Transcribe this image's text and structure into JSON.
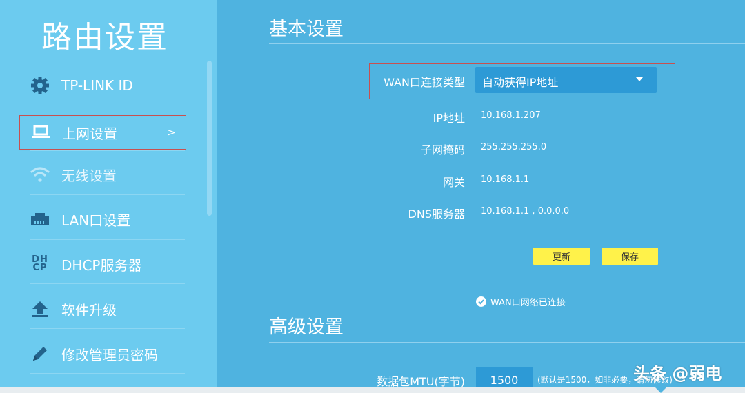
{
  "sidebar": {
    "title": "路由设置",
    "items": [
      {
        "label": "TP-LINK ID",
        "icon": "gear-icon"
      },
      {
        "label": "上网设置",
        "icon": "laptop-icon",
        "chevron": ">"
      },
      {
        "label": "无线设置",
        "icon": "wifi-icon"
      },
      {
        "label": "LAN口设置",
        "icon": "lan-port-icon"
      },
      {
        "label": "DHCP服务器",
        "icon": "dhcp-icon",
        "icon_text": "DH CP"
      },
      {
        "label": "软件升级",
        "icon": "upload-icon"
      },
      {
        "label": "修改管理员密码",
        "icon": "pencil-icon"
      }
    ]
  },
  "basic": {
    "title": "基本设置",
    "wan_type_label": "WAN口连接类型",
    "wan_type_value": "自动获得IP地址",
    "fields": [
      {
        "label": "IP地址",
        "value": "10.168.1.207"
      },
      {
        "label": "子网掩码",
        "value": "255.255.255.0"
      },
      {
        "label": "网关",
        "value": "10.168.1.1"
      },
      {
        "label": "DNS服务器",
        "value": "10.168.1.1 , 0.0.0.0"
      }
    ],
    "refresh_label": "更新",
    "save_label": "保存",
    "status_text": "WAN口网络已连接"
  },
  "advanced": {
    "title": "高级设置",
    "mtu_label": "数据包MTU(字节)",
    "mtu_value": "1500",
    "mtu_hint": "(默认是1500，如非必要，请勿修改)"
  },
  "watermark": "头条 @弱电",
  "colors": {
    "sidebar_bg": "#6ccbef",
    "main_bg": "#4fb3e0",
    "select_bg": "#2d9ad6",
    "button_bg": "#fff24a",
    "highlight_border": "#c85050",
    "icon_color": "#23638c"
  }
}
